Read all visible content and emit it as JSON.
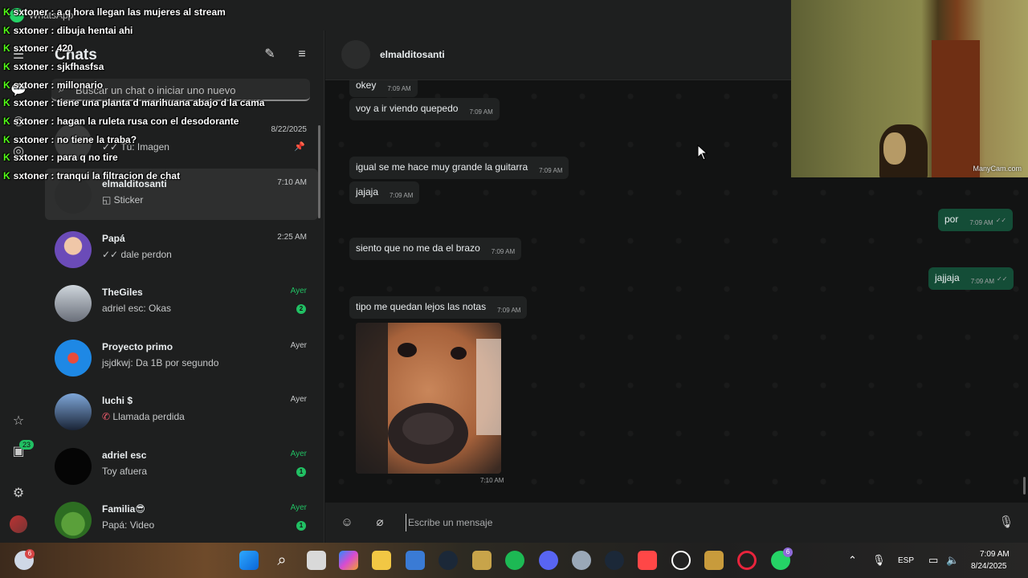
{
  "window": {
    "title": "WhatsApp"
  },
  "sidebar": {
    "heading": "Chats",
    "search_placeholder": "Buscar un chat o iniciar uno nuevo",
    "rail_badge": "23",
    "chats": [
      {
        "name": "",
        "preview": "Tú: Imagen",
        "time": "8/22/2025",
        "pinned": true
      },
      {
        "name": "elmalditosanti",
        "preview": "Sticker",
        "time": "7:10 AM",
        "selected": true
      },
      {
        "name": "Papá",
        "preview": "dale perdon",
        "time": "2:25 AM"
      },
      {
        "name": "TheGiles",
        "preview": "adriel esc: Okas",
        "time": "Ayer",
        "unread": "2"
      },
      {
        "name": "Proyecto primo",
        "preview": "jsjdkwj: Da 1B por segundo",
        "time": "Ayer"
      },
      {
        "name": "luchi $",
        "preview": "Llamada perdida",
        "time": "Ayer"
      },
      {
        "name": "adriel esc",
        "preview": "Toy afuera",
        "time": "Ayer",
        "unread": "1"
      },
      {
        "name": "Familia😎",
        "preview": "Papá: Video",
        "time": "Ayer",
        "unread": "1"
      }
    ]
  },
  "conversation": {
    "contact": "elmalditosanti",
    "messages": [
      {
        "dir": "in",
        "text": "okey",
        "time": "7:09 AM"
      },
      {
        "dir": "in",
        "text": "voy a ir viendo quepedo",
        "time": "7:09 AM"
      },
      {
        "dir": "in",
        "text": "igual se me hace muy grande la guitarra",
        "time": "7:09 AM"
      },
      {
        "dir": "in",
        "text": "jajaja",
        "time": "7:09 AM"
      },
      {
        "dir": "out",
        "text": "por",
        "time": "7:09 AM"
      },
      {
        "dir": "in",
        "text": "siento que no me da el brazo",
        "time": "7:09 AM"
      },
      {
        "dir": "out",
        "text": "jajjaja",
        "time": "7:09 AM"
      },
      {
        "dir": "in",
        "text": "tipo me quedan lejos las notas",
        "time": "7:09 AM"
      }
    ],
    "sticker_time": "7:10 AM",
    "composer_placeholder": "Escribe un mensaje"
  },
  "stream_chat": [
    {
      "user": "sxtoner",
      "text": "a q hora llegan las mujeres al stream"
    },
    {
      "user": "sxtoner",
      "text": "dibuja hentai ahi"
    },
    {
      "user": "sxtoner",
      "text": "420"
    },
    {
      "user": "sxtoner",
      "text": "sjkfhasfsa"
    },
    {
      "user": "sxtoner",
      "text": "millonario"
    },
    {
      "user": "sxtoner",
      "text": "tiene una planta d marihuana abajo d la cama"
    },
    {
      "user": "sxtoner",
      "text": "hagan la ruleta rusa con el desodorante"
    },
    {
      "user": "sxtoner",
      "text": "no tiene la traba?"
    },
    {
      "user": "sxtoner",
      "text": "para q no tire"
    },
    {
      "user": "sxtoner",
      "text": "tranqui la filtracion de chat"
    }
  ],
  "webcam": {
    "watermark": "ManyCam.com"
  },
  "taskbar": {
    "language": "ESP",
    "time": "7:09 AM",
    "date": "8/24/2025",
    "weather_badge": "6",
    "whatsapp_badge": "6"
  },
  "colors": {
    "accent": "#21c063",
    "outgoing_bubble": "#144d37",
    "incoming_bubble": "#202222",
    "kick_green": "#53fc18"
  }
}
